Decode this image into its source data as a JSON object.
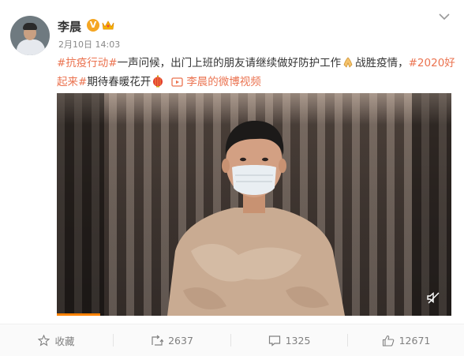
{
  "post": {
    "author": "李晨",
    "verified_badge": "V",
    "timestamp": "2月10日 14:03",
    "text_segments": [
      {
        "text": "#抗疫行动#",
        "type": "tag"
      },
      {
        "text": "一声问候，出门上班的朋友请继续做好防护工作",
        "type": "text"
      },
      {
        "text": "战胜疫情，",
        "type": "text"
      },
      {
        "text": "#2020好起来#",
        "type": "tag"
      },
      {
        "text": "期待春暖花开",
        "type": "text"
      }
    ],
    "video_link": "李晨的微博视频",
    "video_progress_fraction": 0.11
  },
  "actions": {
    "favorite_label": "收藏",
    "repost_count": "2637",
    "comment_count": "1325",
    "like_count": "12671"
  },
  "icons": {
    "verified": "verified-v-icon",
    "crown": "vip-crown-icon",
    "more": "chevron-down-icon",
    "favorite": "star-icon",
    "repost": "repost-icon",
    "comment": "comment-icon",
    "like": "thumbs-up-icon",
    "video": "video-play-icon",
    "mute": "mute-icon"
  },
  "colors": {
    "accent": "#eb7350",
    "progress": "#ff8200",
    "text": "#333333",
    "muted": "#808080"
  }
}
